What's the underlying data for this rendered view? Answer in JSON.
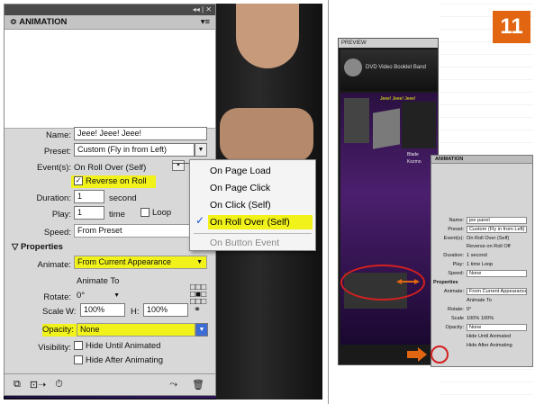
{
  "left_panel": {
    "title": "ANIMATION",
    "topbar_controls": "◂◂ | ✕",
    "menu_icon": "▾≡",
    "name_label": "Name:",
    "name_value": "Jeee! Jeee! Jeee!",
    "preset_label": "Preset:",
    "preset_value": "Custom (Fly in from Left)",
    "events_label": "Event(s):",
    "events_value": "On Roll Over (Self)",
    "reverse_label": "Reverse on Roll Off",
    "reverse_checked": true,
    "duration_label": "Duration:",
    "duration_value": "1",
    "duration_unit": "second",
    "play_label": "Play:",
    "play_value": "1",
    "play_unit": "time",
    "loop_label": "Loop",
    "speed_label": "Speed:",
    "speed_value": "From Preset",
    "properties_label": "Properties",
    "animate_label": "Animate:",
    "animate_value": "From Current Appearance",
    "animate_to_label": "Animate To",
    "rotate_label": "Rotate:",
    "rotate_value": "0°",
    "scale_label": "Scale",
    "scale_w_label": "W:",
    "scale_w_value": "100%",
    "scale_h_label": "H:",
    "scale_h_value": "100%",
    "opacity_label": "Opacity:",
    "opacity_value": "None",
    "visibility_label": "Visibility:",
    "hide_until_label": "Hide Until Animated",
    "hide_after_label": "Hide After Animating"
  },
  "event_menu": {
    "items": [
      "On Page Load",
      "On Page Click",
      "On Click (Self)",
      "On Roll Over (Self)"
    ],
    "selected": "On Roll Over (Self)",
    "disabled_item": "On Button Event"
  },
  "right_screenshot": {
    "step_number": "11",
    "preview_title": "PREVIEW",
    "preview_brand": "DVD Video Booklet Band",
    "band_names": [
      "Jeee! Jeee! Jeee!",
      "Blade",
      "Kozmo"
    ],
    "mini_panel": {
      "title": "ANIMATION",
      "name_value": "jee panel",
      "preset_value": "Custom (Fly in from Left)",
      "events_value": "On Roll Over (Self)",
      "reverse_label": "Reverse on Roll Off",
      "duration_value": "1",
      "duration_unit": "second",
      "play_value": "1",
      "play_unit": "time",
      "loop_label": "Loop",
      "speed_value": "None",
      "properties_label": "Properties",
      "animate_value": "From Current Appearance",
      "animate_to_label": "Animate To",
      "rotate_value": "0°",
      "scale_w": "100%",
      "scale_h": "100%",
      "opacity_value": "None",
      "hide_until_label": "Hide Until Animated",
      "hide_after_label": "Hide After Animating"
    }
  },
  "colors": {
    "highlight": "#f1f21a",
    "badge": "#e26612",
    "callout_red": "#d42020",
    "check_blue": "#1a4fd6"
  }
}
